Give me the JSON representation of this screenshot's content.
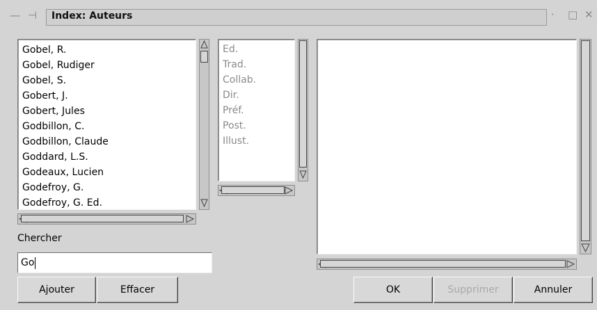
{
  "window": {
    "title": "Index: Auteurs",
    "controls": {
      "menu": "—",
      "pin": "⊣",
      "minimize": "·",
      "maximize": "□",
      "close": "✕"
    }
  },
  "authors": {
    "items": [
      "Gobel, R.",
      "Gobel, Rudiger",
      "Gobel, S.",
      "Gobert, J.",
      "Gobert, Jules",
      "Godbillon, C.",
      "Godbillon, Claude",
      "Goddard, L.S.",
      "Godeaux, Lucien",
      "Godefroy, G.",
      "Godefroy, G. Ed."
    ]
  },
  "roles": {
    "items": [
      "Ed.",
      "Trad.",
      "Collab.",
      "Dir.",
      "Préf.",
      "Post.",
      "Illust."
    ]
  },
  "search": {
    "label": "Chercher",
    "value": "Go"
  },
  "buttons": {
    "add": "Ajouter",
    "clear": "Effacer",
    "ok": "OK",
    "delete": "Supprimer",
    "cancel": "Annuler"
  }
}
